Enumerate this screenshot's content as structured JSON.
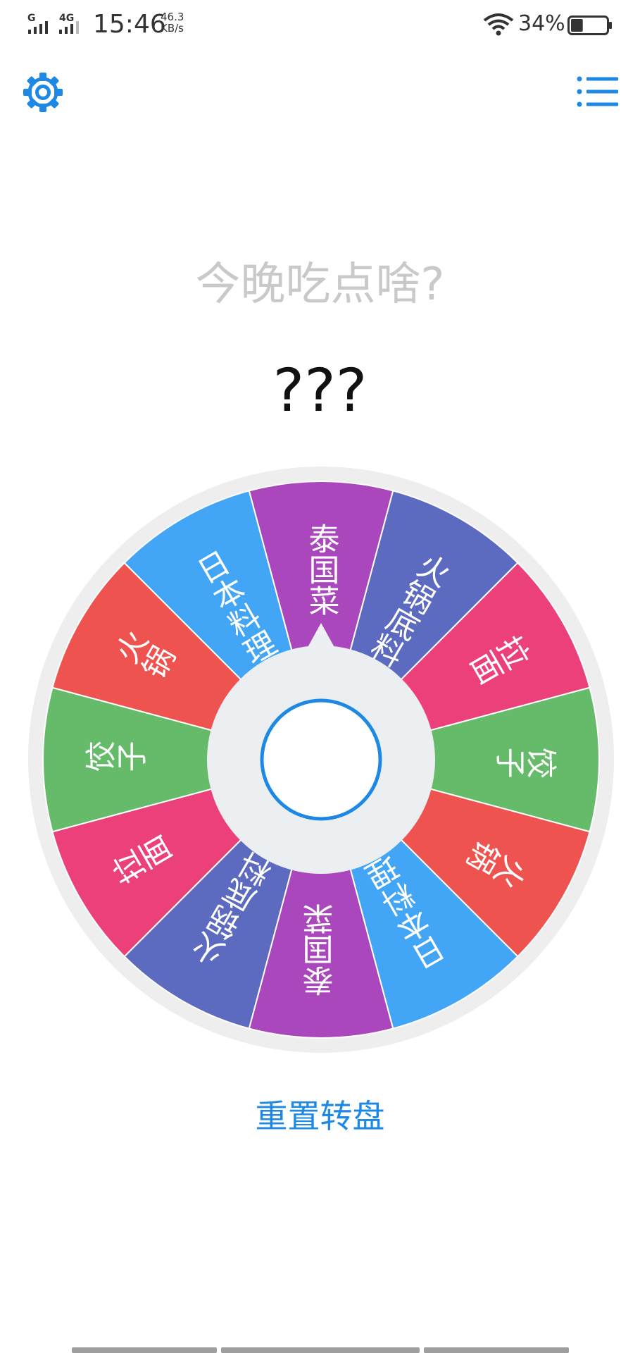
{
  "status_bar": {
    "network1": "G",
    "network2": "4G",
    "time": "15:46",
    "speed_value": "46.3",
    "speed_unit": "KB/s",
    "battery": "34%",
    "battery_level": 0.34
  },
  "header": {
    "settings_icon": "gear-icon",
    "menu_icon": "list-icon",
    "accent": "#1e88e5"
  },
  "question": "今晚吃点啥?",
  "result": "???",
  "wheel": {
    "segments": [
      {
        "label": "泰国菜",
        "color": "#ab47bc"
      },
      {
        "label": "火锅底料",
        "color": "#5c6bc0"
      },
      {
        "label": "拉面",
        "color": "#ec407a"
      },
      {
        "label": "饺子",
        "color": "#66bb6a"
      },
      {
        "label": "火锅",
        "color": "#ef5350"
      },
      {
        "label": "日本料理",
        "color": "#42a5f5"
      },
      {
        "label": "泰国菜",
        "color": "#ab47bc"
      },
      {
        "label": "火锅底料",
        "color": "#5c6bc0"
      },
      {
        "label": "拉面",
        "color": "#ec407a"
      },
      {
        "label": "饺子",
        "color": "#66bb6a"
      },
      {
        "label": "火锅",
        "color": "#ef5350"
      },
      {
        "label": "日本料理",
        "color": "#42a5f5"
      }
    ]
  },
  "reset_button": "重置转盘"
}
